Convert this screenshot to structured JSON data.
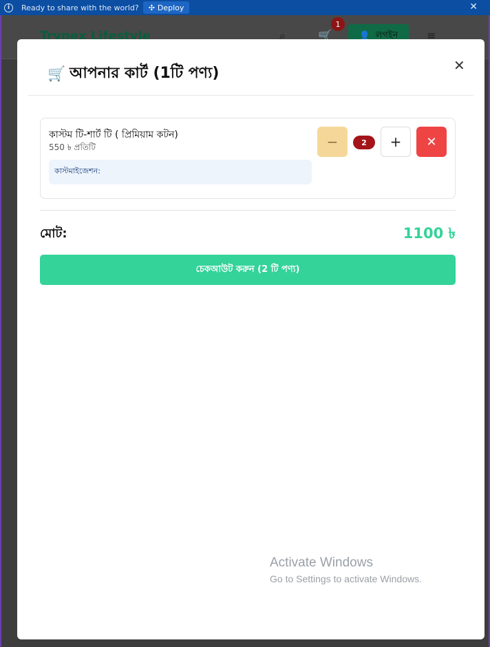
{
  "banner": {
    "message": "Ready to share with the world?",
    "deploy_label": "Deploy"
  },
  "site": {
    "brand": "Trynex Lifestyle",
    "cart_count": "1",
    "login_label": "লগইন"
  },
  "modal": {
    "title": "আপনার কার্ট (1টি পণ্য)",
    "items": [
      {
        "name": "কাস্টম টি-শার্ট টি ( প্রিমিয়াম কটন)",
        "price": "550 ৳ প্রতিটি",
        "customization_label": "কাস্টমাইজেশন:",
        "quantity": "2"
      }
    ],
    "total_label": "মোট:",
    "total_value": "1100 ৳",
    "checkout_label": "চেকআউট করুন (2 টি পণ্য)"
  },
  "watermark": {
    "line1": "Activate Windows",
    "line2": "Go to Settings to activate Windows."
  },
  "colors": {
    "accent": "#34d399",
    "danger": "#ef4444",
    "badge": "#a4141a"
  }
}
